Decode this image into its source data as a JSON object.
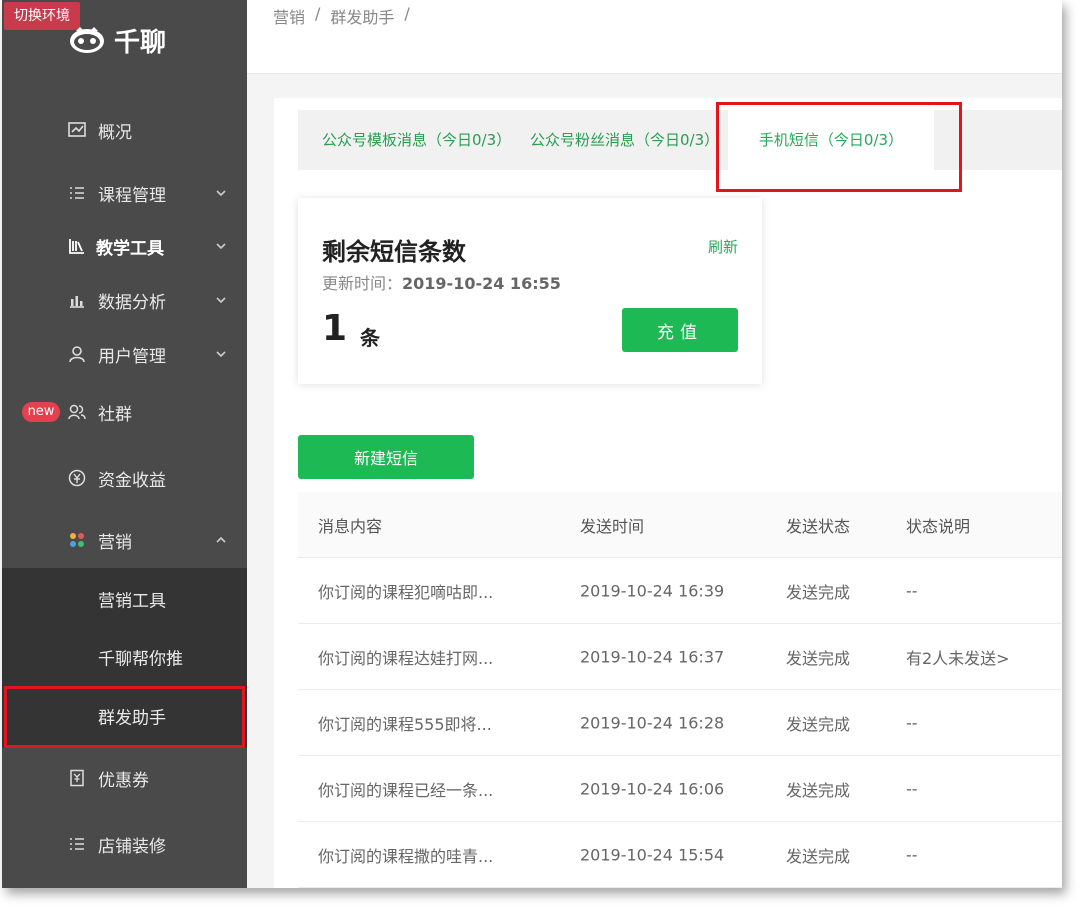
{
  "env_badge": "切换环境",
  "brand": {
    "name": "千聊"
  },
  "sidebar": {
    "items": [
      {
        "label": "概况",
        "icon": "chart-icon"
      },
      {
        "label": "课程管理",
        "icon": "list-icon"
      },
      {
        "label": "教学工具",
        "icon": "books-icon"
      },
      {
        "label": "数据分析",
        "icon": "bar-chart-icon"
      },
      {
        "label": "用户管理",
        "icon": "user-icon"
      },
      {
        "label": "社群",
        "icon": "group-icon",
        "badge": "new"
      },
      {
        "label": "资金收益",
        "icon": "money-icon"
      },
      {
        "label": "营销",
        "icon": "grid-icon"
      },
      {
        "label": "优惠券",
        "icon": "coupon-icon"
      },
      {
        "label": "店铺装修",
        "icon": "list-icon"
      }
    ],
    "submenu": [
      "营销工具",
      "千聊帮你推",
      "群发助手"
    ]
  },
  "breadcrumb": [
    "营销",
    "/",
    "群发助手",
    "/"
  ],
  "tabs": [
    "公众号模板消息（今日0/3）",
    "公众号粉丝消息（今日0/3）",
    "手机短信（今日0/3）"
  ],
  "sms_card": {
    "title": "剩余短信条数",
    "update_label": "更新时间：",
    "update_time": "2019-10-24 16:55",
    "refresh": "刷新",
    "count": "1",
    "unit": "条",
    "recharge": "充值"
  },
  "new_sms_button": "新建短信",
  "table": {
    "headers": [
      "消息内容",
      "发送时间",
      "发送状态",
      "状态说明"
    ],
    "rows": [
      [
        "你订阅的课程犯嘀咕即...",
        "2019-10-24 16:39",
        "发送完成",
        "--"
      ],
      [
        "你订阅的课程达娃打网...",
        "2019-10-24 16:37",
        "发送完成",
        "有2人未发送>"
      ],
      [
        "你订阅的课程555即将...",
        "2019-10-24 16:28",
        "发送完成",
        "--"
      ],
      [
        "你订阅的课程已经一条...",
        "2019-10-24 16:06",
        "发送完成",
        "--"
      ],
      [
        "你订阅的课程撒的哇青...",
        "2019-10-24 15:54",
        "发送完成",
        "--"
      ]
    ]
  },
  "colors": {
    "accent": "#1db954",
    "sidebar": "#4a4a4a",
    "highlight": "#e0161c",
    "badge": "#e4404f"
  }
}
